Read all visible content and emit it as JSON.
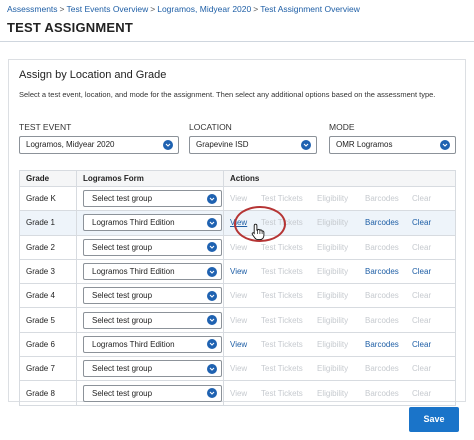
{
  "breadcrumb": {
    "items": [
      "Assessments",
      "Test Events Overview",
      "Logramos, Midyear 2020",
      "Test Assignment Overview"
    ]
  },
  "page_title": "TEST ASSIGNMENT",
  "panel": {
    "title": "Assign by Location and Grade",
    "description": "Select a test event, location, and mode for the assignment. Then select any additional options based on the assessment type."
  },
  "fields": {
    "test_event": {
      "label": "TEST EVENT",
      "value": "Logramos, Midyear 2020"
    },
    "location": {
      "label": "LOCATION",
      "value": "Grapevine ISD"
    },
    "mode": {
      "label": "MODE",
      "value": "OMR Logramos"
    }
  },
  "table": {
    "headers": [
      "Grade",
      "Logramos Form",
      "Actions"
    ],
    "action_labels": [
      "View",
      "Test Tickets",
      "Eligibility",
      "Barcodes",
      "Clear"
    ],
    "rows": [
      {
        "grade": "Grade K",
        "form": "Select test group",
        "enabled": false
      },
      {
        "grade": "Grade 1",
        "form": "Logramos Third Edition",
        "enabled": true
      },
      {
        "grade": "Grade 2",
        "form": "Select test group",
        "enabled": false
      },
      {
        "grade": "Grade 3",
        "form": "Logramos Third Edition",
        "enabled": true
      },
      {
        "grade": "Grade 4",
        "form": "Select test group",
        "enabled": false
      },
      {
        "grade": "Grade 5",
        "form": "Select test group",
        "enabled": false
      },
      {
        "grade": "Grade 6",
        "form": "Logramos Third Edition",
        "enabled": true
      },
      {
        "grade": "Grade 7",
        "form": "Select test group",
        "enabled": false
      },
      {
        "grade": "Grade 8",
        "form": "Select test group",
        "enabled": false
      }
    ]
  },
  "save_label": "Save",
  "colors": {
    "accent": "#1f62b1",
    "link": "#1f5fa6",
    "disabled": "#c6cacf",
    "annotation": "#b53434",
    "save_button": "#1a74c9"
  }
}
